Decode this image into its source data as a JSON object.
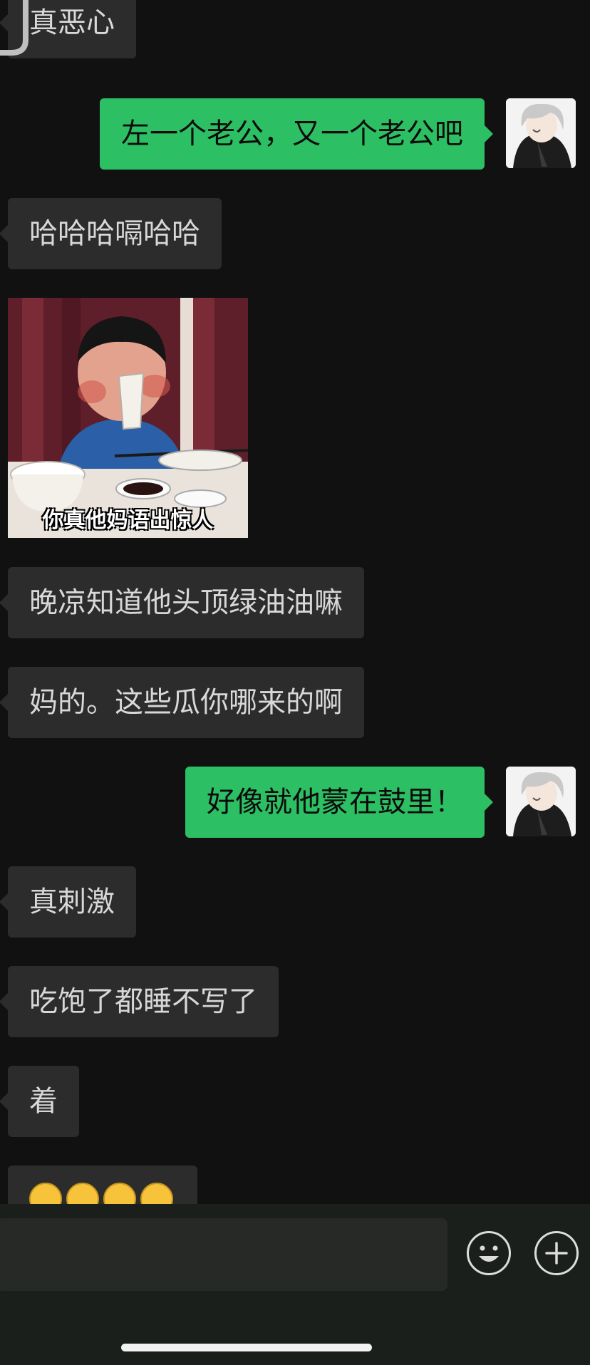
{
  "messages": [
    {
      "side": "in",
      "text": "真恶心"
    },
    {
      "side": "out",
      "text": "左一个老公，又一个老公吧"
    },
    {
      "side": "in",
      "text": "哈哈哈嗝哈哈"
    },
    {
      "side": "in",
      "type": "sticker",
      "caption": "你真他妈语出惊人"
    },
    {
      "side": "in",
      "text": "晚凉知道他头顶绿油油嘛"
    },
    {
      "side": "in",
      "text": "妈的。这些瓜你哪来的啊"
    },
    {
      "side": "out",
      "text": "好像就他蒙在鼓里！"
    },
    {
      "side": "in",
      "text": "真刺激"
    },
    {
      "side": "in",
      "text": "吃饱了都睡不写了"
    },
    {
      "side": "in",
      "text": "着"
    },
    {
      "side": "in",
      "type": "emoji",
      "emoji": [
        "grinning-face",
        "grinning-face",
        "grinning-face",
        "grinning-face"
      ]
    }
  ],
  "input": {
    "value": "",
    "placeholder": ""
  },
  "icons": {
    "emoji_button": "smiley-face-icon",
    "more_button": "plus-icon"
  },
  "colors": {
    "background": "#111111",
    "incoming_bubble": "#2c2c2c",
    "outgoing_bubble": "#2dbf63",
    "bottom_bar": "#1b1f1c"
  }
}
